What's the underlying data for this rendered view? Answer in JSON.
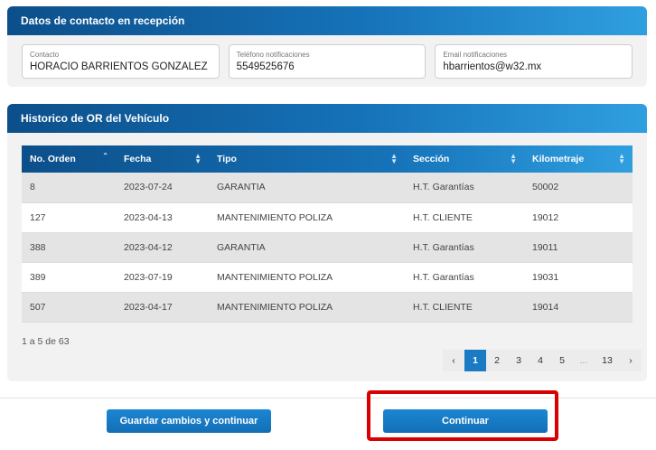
{
  "contact": {
    "title": "Datos de contacto en recepción",
    "fields": [
      {
        "label": "Contacto",
        "value": "HORACIO BARRIENTOS GONZALEZ"
      },
      {
        "label": "Teléfono notificaciones",
        "value": "5549525676"
      },
      {
        "label": "Email notificaciones",
        "value": "hbarrientos@w32.mx"
      }
    ]
  },
  "history": {
    "title": "Historico de OR del Vehículo",
    "columns": [
      "No. Orden",
      "Fecha",
      "Tipo",
      "Sección",
      "Kilometraje"
    ],
    "rows": [
      [
        "8",
        "2023-07-24",
        "GARANTIA",
        "H.T. Garantías",
        "50002"
      ],
      [
        "127",
        "2023-04-13",
        "MANTENIMIENTO POLIZA",
        "H.T. CLIENTE",
        "19012"
      ],
      [
        "388",
        "2023-04-12",
        "GARANTIA",
        "H.T. Garantías",
        "19011"
      ],
      [
        "389",
        "2023-07-19",
        "MANTENIMIENTO POLIZA",
        "H.T. Garantías",
        "19031"
      ],
      [
        "507",
        "2023-04-17",
        "MANTENIMIENTO POLIZA",
        "H.T. CLIENTE",
        "19014"
      ]
    ],
    "count_text": "1 a 5 de 63",
    "pagination": {
      "prev": "‹",
      "pages": [
        "1",
        "2",
        "3",
        "4",
        "5"
      ],
      "ellipsis": "...",
      "last": "13",
      "next": "›",
      "active": "1"
    }
  },
  "actions": {
    "save_label": "Guardar cambios y continuar",
    "continue_label": "Continuar"
  },
  "colors": {
    "accent": "#1a7ac4",
    "highlight": "#d90000"
  }
}
